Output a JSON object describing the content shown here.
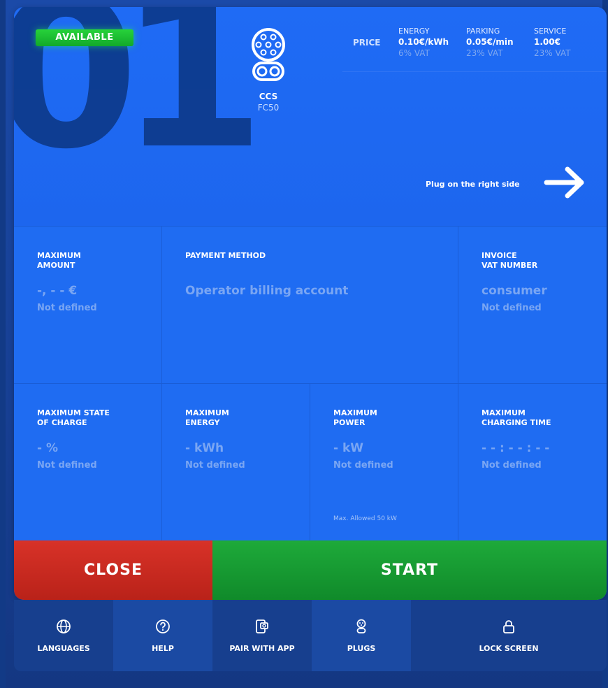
{
  "header": {
    "connector_number": "01",
    "status_badge": "AVAILABLE",
    "connector_type": "CCS",
    "connector_model": "FC50",
    "price_label": "PRICE",
    "prices": [
      {
        "title": "ENERGY",
        "value": "0.10€/kWh",
        "vat": "6% VAT"
      },
      {
        "title": "PARKING",
        "value": "0.05€/min",
        "vat": "23% VAT"
      },
      {
        "title": "SERVICE",
        "value": "1.00€",
        "vat": "23% VAT"
      }
    ],
    "plug_hint": "Plug on the right side",
    "icons": {
      "connector": "ccs-connector-icon",
      "arrow": "arrow-right-icon"
    }
  },
  "tiles": {
    "max_amount": {
      "label": "MAXIMUM\nAMOUNT",
      "value": "-, - - €",
      "sub": "Not defined"
    },
    "payment": {
      "label": "PAYMENT METHOD",
      "value": "Operator billing account"
    },
    "invoice": {
      "label": "INVOICE\nVAT NUMBER",
      "value": "consumer",
      "sub": "Not defined"
    },
    "max_soc": {
      "label": "MAXIMUM STATE\nOF CHARGE",
      "value": "- %",
      "sub": "Not defined"
    },
    "max_energy": {
      "label": "MAXIMUM\nENERGY",
      "value": "- kWh",
      "sub": "Not defined"
    },
    "max_power": {
      "label": "MAXIMUM\nPOWER",
      "value": "- kW",
      "sub": "Not defined",
      "note": "Max. Allowed 50 kW"
    },
    "max_time": {
      "label": "MAXIMUM\nCHARGING TIME",
      "value": "- - : - - : - -",
      "sub": "Not defined"
    }
  },
  "actions": {
    "close": "CLOSE",
    "start": "START"
  },
  "nav": [
    {
      "label": "LANGUAGES",
      "icon": "globe-icon"
    },
    {
      "label": "HELP",
      "icon": "help-icon"
    },
    {
      "label": "PAIR WITH APP",
      "icon": "pair-app-icon"
    },
    {
      "label": "PLUGS",
      "icon": "plug-icon"
    },
    {
      "label": "LOCK SCREEN",
      "icon": "lock-icon"
    }
  ],
  "colors": {
    "panel": "#1f6bf0",
    "available": "#1bbf33",
    "close": "#c8281f",
    "start": "#15992f",
    "nav": "#173f8e"
  }
}
